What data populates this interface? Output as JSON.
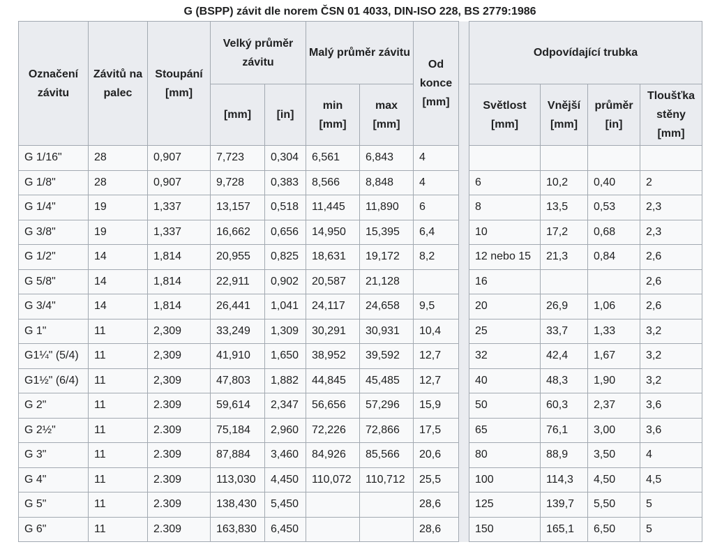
{
  "caption": "G (BSPP) závit dle norem ČSN 01 4033, DIN-ISO 228, BS 2779:1986",
  "headers": {
    "designation": "Označení závitu",
    "tpi": "Závitů na palec",
    "pitch": "Stoupání [mm]",
    "major": "Velký průměr závitu",
    "major_mm": "[mm]",
    "major_in": "[in]",
    "minor": "Malý průměr závitu",
    "minor_min": "min [mm]",
    "minor_max": "max [mm]",
    "from_end": "Od konce [mm]",
    "pipe": "Odpovídající trubka",
    "pipe_bore": "Světlost [mm]",
    "pipe_outer": "Vnější [mm]",
    "pipe_diam": "průměr [in]",
    "pipe_wall": "Tloušťka stěny [mm]"
  },
  "rows": [
    [
      "G 1/16\"",
      "28",
      "0,907",
      "7,723",
      "0,304",
      "6,561",
      "6,843",
      "4",
      "",
      "",
      "",
      ""
    ],
    [
      "G 1/8\"",
      "28",
      "0,907",
      "9,728",
      "0,383",
      "8,566",
      "8,848",
      "4",
      "6",
      "10,2",
      "0,40",
      "2"
    ],
    [
      "G 1/4\"",
      "19",
      "1,337",
      "13,157",
      "0,518",
      "11,445",
      "11,890",
      "6",
      "8",
      "13,5",
      "0,53",
      "2,3"
    ],
    [
      "G 3/8\"",
      "19",
      "1,337",
      "16,662",
      "0,656",
      "14,950",
      "15,395",
      "6,4",
      "10",
      "17,2",
      "0,68",
      "2,3"
    ],
    [
      "G 1/2\"",
      "14",
      "1,814",
      "20,955",
      "0,825",
      "18,631",
      "19,172",
      "8,2",
      "12 nebo 15",
      "21,3",
      "0,84",
      "2,6"
    ],
    [
      "G 5/8\"",
      "14",
      "1,814",
      "22,911",
      "0,902",
      "20,587",
      "21,128",
      "",
      "16",
      "",
      "",
      "2,6"
    ],
    [
      "G 3/4\"",
      "14",
      "1,814",
      "26,441",
      "1,041",
      "24,117",
      "24,658",
      "9,5",
      "20",
      "26,9",
      "1,06",
      "2,6"
    ],
    [
      "G 1\"",
      "11",
      "2,309",
      "33,249",
      "1,309",
      "30,291",
      "30,931",
      "10,4",
      "25",
      "33,7",
      "1,33",
      "3,2"
    ],
    [
      "G1¼\" (5/4)",
      "11",
      "2,309",
      "41,910",
      "1,650",
      "38,952",
      "39,592",
      "12,7",
      "32",
      "42,4",
      "1,67",
      "3,2"
    ],
    [
      "G1½\" (6/4)",
      "11",
      "2,309",
      "47,803",
      "1,882",
      "44,845",
      "45,485",
      "12,7",
      "40",
      "48,3",
      "1,90",
      "3,2"
    ],
    [
      "G 2\"",
      "11",
      "2.309",
      "59,614",
      "2,347",
      "56,656",
      "57,296",
      "15,9",
      "50",
      "60,3",
      "2,37",
      "3,6"
    ],
    [
      "G 2½\"",
      "11",
      "2.309",
      "75,184",
      "2,960",
      "72,226",
      "72,866",
      "17,5",
      "65",
      "76,1",
      "3,00",
      "3,6"
    ],
    [
      "G 3\"",
      "11",
      "2.309",
      "87,884",
      "3,460",
      "84,926",
      "85,566",
      "20,6",
      "80",
      "88,9",
      "3,50",
      "4"
    ],
    [
      "G 4\"",
      "11",
      "2.309",
      "113,030",
      "4,450",
      "110,072",
      "110,712",
      "25,5",
      "100",
      "114,3",
      "4,50",
      "4,5"
    ],
    [
      "G 5\"",
      "11",
      "2.309",
      "138,430",
      "5,450",
      "",
      "",
      "28,6",
      "125",
      "139,7",
      "5,50",
      "5"
    ],
    [
      "G 6\"",
      "11",
      "2.309",
      "163,830",
      "6,450",
      "",
      "",
      "28,6",
      "150",
      "165,1",
      "6,50",
      "5"
    ]
  ]
}
